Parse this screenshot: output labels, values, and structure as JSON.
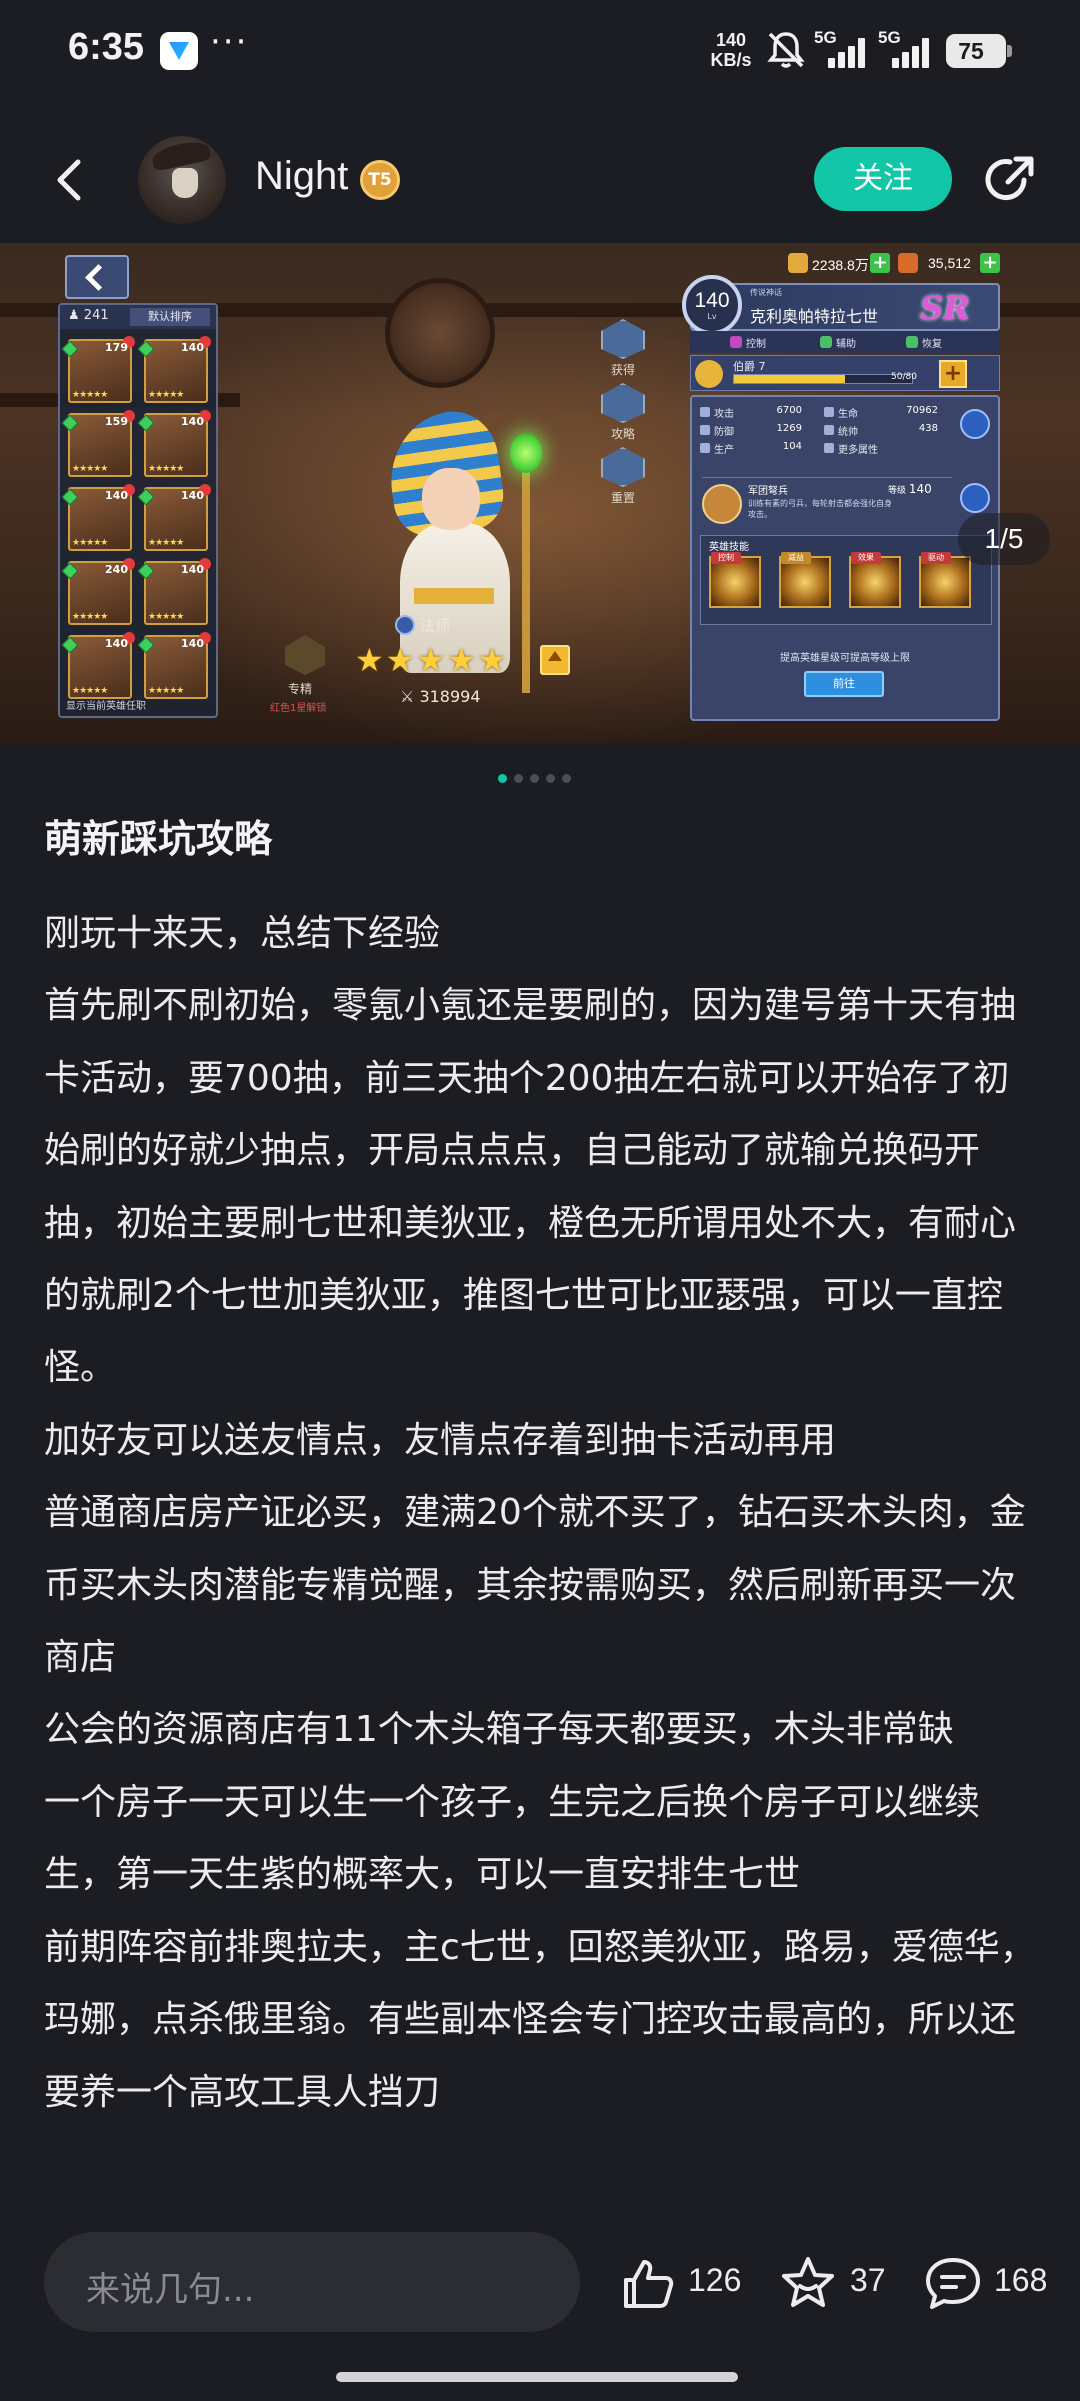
{
  "status_bar": {
    "time": "6:35",
    "more": "···",
    "net_speed_value": "140",
    "net_speed_unit": "KB/s",
    "signal_1_label": "5G",
    "signal_2_label": "5G",
    "battery": "75"
  },
  "header": {
    "username": "Night",
    "level_badge": "T5",
    "follow_label": "关注"
  },
  "carousel": {
    "page_counter": "1/5",
    "dots_count": 5,
    "active_index": 0,
    "game": {
      "hero_count": "241",
      "sort_label": "默认排序",
      "list_footer": "显示当前英雄任职",
      "currency_1": "2238.8万",
      "currency_2": "35,512",
      "hero_levels": [
        "179",
        "140",
        "159",
        "140",
        "140",
        "140",
        "240",
        "140",
        "140",
        "140"
      ],
      "side_menu": [
        "获得",
        "攻略",
        "重置"
      ],
      "class_label": "法师",
      "stars": "★★★★★",
      "lock_label": "专精",
      "unlock_note": "红色1星解锁",
      "power": "318994",
      "hero_level": "140",
      "hero_level_sub": "Lv",
      "hero_sub": "传说神话",
      "hero_name": "克利奥帕特拉七世",
      "rarity": "SR",
      "roles": [
        "控制",
        "辅助",
        "恢复"
      ],
      "rank_label": "伯爵 7",
      "rank_progress_text": "50/80",
      "rank_progress": 0.625,
      "stats": [
        {
          "label": "攻击",
          "value": "6700"
        },
        {
          "label": "生命",
          "value": "70962"
        },
        {
          "label": "防御",
          "value": "1269"
        },
        {
          "label": "统帅",
          "value": "438"
        },
        {
          "label": "生产",
          "value": "104"
        },
        {
          "label": "更多属性",
          "value": ""
        }
      ],
      "troop_name": "军团弩兵",
      "troop_level_label": "等级",
      "troop_level": "140",
      "troop_desc": "训练有素的弓兵，每轮射击都会强化自身攻击。",
      "skills_title": "英雄技能",
      "skill_tags": [
        "控制",
        "减益",
        "效果",
        "驱动"
      ],
      "upgrade_note": "提高英雄星级可提高等级上限",
      "goto_label": "前往"
    }
  },
  "article": {
    "title": "萌新踩坑攻略",
    "paragraphs": [
      "刚玩十来天，总结下经验",
      "首先刷不刷初始，零氪小氪还是要刷的，因为建号第十天有抽卡活动，要700抽，前三天抽个200抽左右就可以开始存了初始刷的好就少抽点，开局点点点，自己能动了就输兑换码开抽，初始主要刷七世和美狄亚，橙色无所谓用处不大，有耐心的就刷2个七世加美狄亚，推图七世可比亚瑟强，可以一直控怪。",
      "加好友可以送友情点，友情点存着到抽卡活动再用",
      "普通商店房产证必买，建满20个就不买了，钻石买木头肉，金币买木头肉潜能专精觉醒，其余按需购买，然后刷新再买一次商店",
      "公会的资源商店有11个木头箱子每天都要买，木头非常缺",
      "一个房子一天可以生一个孩子，生完之后换个房子可以继续生，第一天生紫的概率大，可以一直安排生七世",
      "前期阵容前排奥拉夫，主c七世，回怒美狄亚，路易，爱德华，玛娜，点杀俄里翁。有些副本怪会专门控攻击最高的，所以还要养一个高攻工具人挡刀"
    ]
  },
  "bottom_bar": {
    "comment_placeholder": "来说几句...",
    "likes": "126",
    "favorites": "37",
    "comments": "168"
  },
  "colors": {
    "background": "#1c1d22",
    "accent": "#12c6a8",
    "text": "#ececef",
    "muted": "#8b8c93"
  }
}
